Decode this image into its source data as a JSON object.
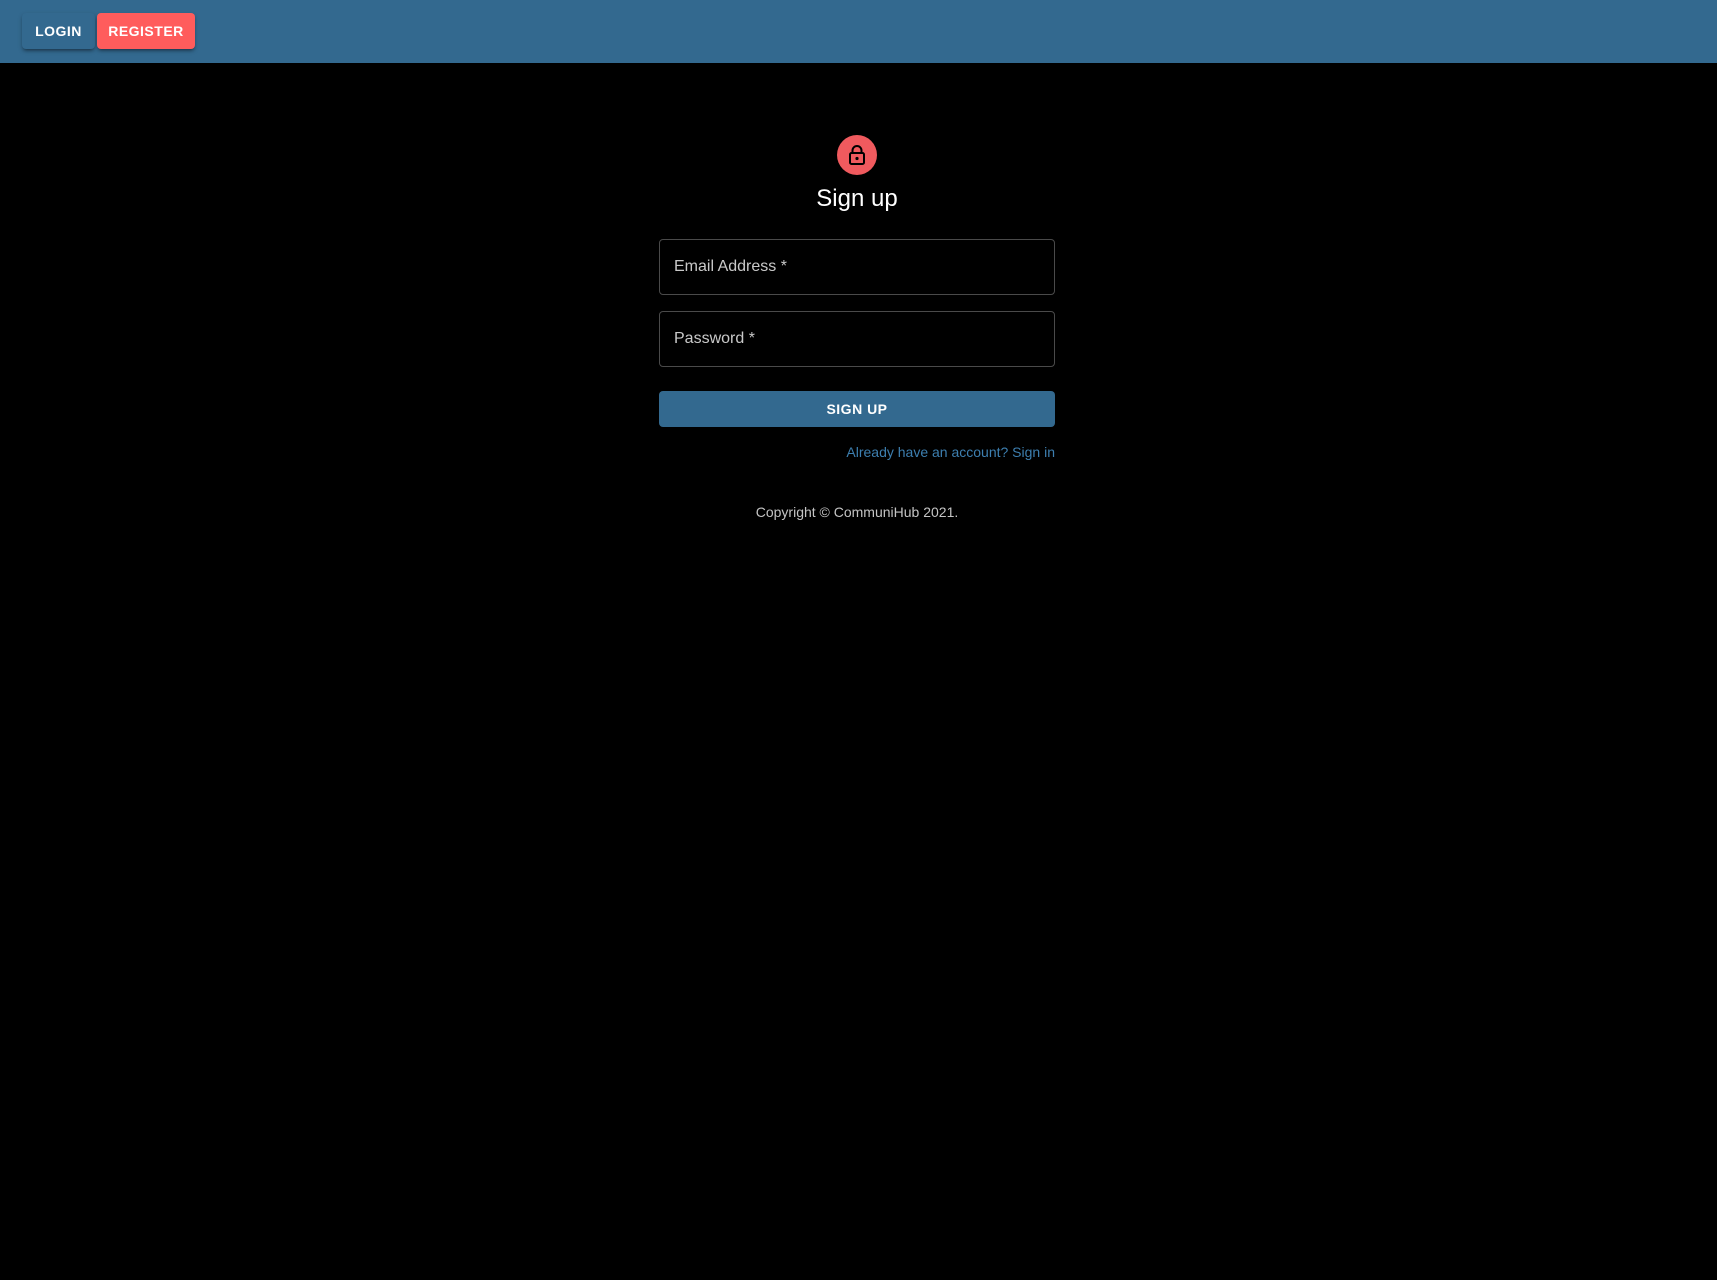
{
  "nav": {
    "login_label": "LOGIN",
    "register_label": "REGISTER"
  },
  "form": {
    "title": "Sign up",
    "email": {
      "label": "Email Address *",
      "value": ""
    },
    "password": {
      "label": "Password *",
      "value": ""
    },
    "submit_label": "SIGN UP",
    "signin_link": "Already have an account? Sign in"
  },
  "footer": {
    "copyright": "Copyright © CommuniHub 2021."
  },
  "icons": {
    "avatar_icon": "lock-icon"
  },
  "colors": {
    "appbar": "#33698f",
    "accent": "#ff5c5c",
    "avatar": "#f05a5e",
    "link": "#3d7fb0",
    "background": "#000000"
  }
}
